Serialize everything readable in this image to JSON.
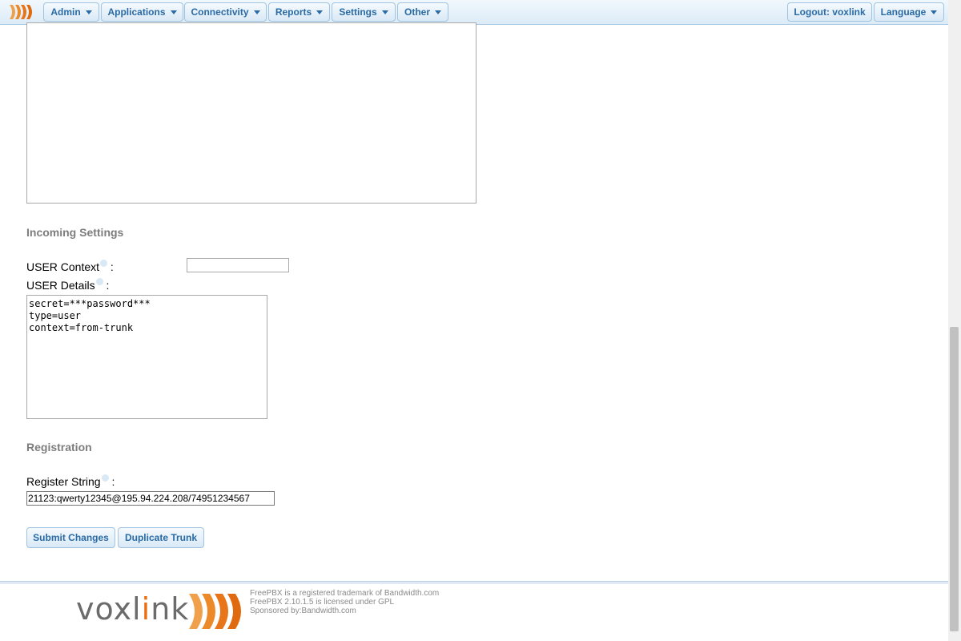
{
  "nav": {
    "logo_icon": "freepbx-logo",
    "items": [
      {
        "label": "Admin"
      },
      {
        "label": "Applications"
      },
      {
        "label": "Connectivity"
      },
      {
        "label": "Reports"
      },
      {
        "label": "Settings"
      },
      {
        "label": "Other"
      }
    ],
    "logout_label": "Logout: voxlink",
    "language_label": "Language"
  },
  "incoming": {
    "title": "Incoming Settings",
    "user_context_label": "USER Context",
    "user_context_value": "",
    "user_details_label": "USER Details",
    "user_details_value": "secret=***password***\ntype=user\ncontext=from-trunk"
  },
  "registration": {
    "title": "Registration",
    "register_string_label": "Register String",
    "register_string_value": "21123:qwerty12345@195.94.224.208/74951234567"
  },
  "actions": {
    "submit_label": "Submit Changes",
    "duplicate_label": "Duplicate Trunk"
  },
  "footer": {
    "brand_prefix": "voxl",
    "brand_accent": "i",
    "brand_suffix": "nk",
    "line1": "FreePBX is a registered trademark of Bandwidth.com",
    "line2": "FreePBX 2.10.1.5 is licensed under GPL",
    "line3": "Sponsored by:Bandwidth.com"
  },
  "colors": {
    "accent": "#e86f12",
    "nav_text": "#2a6aa5",
    "section_title": "#7d7d7d"
  }
}
